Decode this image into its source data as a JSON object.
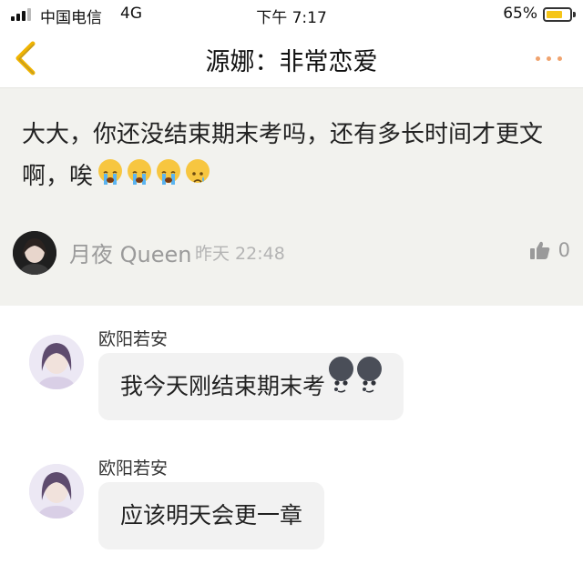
{
  "status_bar": {
    "carrier": "中国电信",
    "network": "4G",
    "time": "下午 7:17",
    "battery_percent": "65%"
  },
  "nav": {
    "title": "源娜：非常恋爱"
  },
  "post": {
    "text": "大大，你还没结束期末考吗，还有多长时间才更文啊，唉",
    "emoji": [
      "loudly-crying-face",
      "loudly-crying-face",
      "loudly-crying-face",
      "crying-face"
    ],
    "author": "月夜 Queen",
    "time": "昨天 22:48",
    "like_count": "0"
  },
  "replies": [
    {
      "name": "欧阳若安",
      "text": "我今天刚结束期末考",
      "emoji": [
        "new-moon-face",
        "new-moon-face"
      ]
    },
    {
      "name": "欧阳若安",
      "text": "应该明天会更一章",
      "emoji": []
    }
  ],
  "colors": {
    "accent_dots": "#f0a36e",
    "back_arrow": "#f0b400",
    "battery_fill": "#f5c518",
    "post_background": "#f2f2ee",
    "bubble_background": "#f2f2f2"
  }
}
